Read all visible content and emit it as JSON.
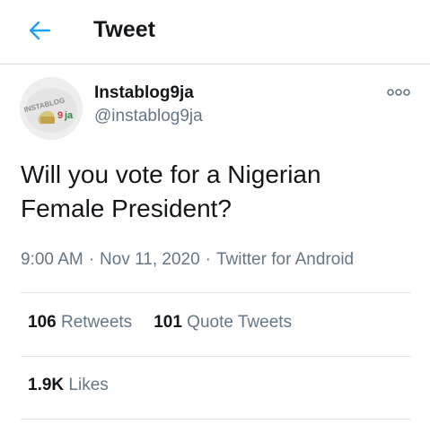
{
  "header": {
    "title": "Tweet",
    "back_icon": "arrow-left-icon",
    "accent": "#1da1f2"
  },
  "author": {
    "name": "Instablog9ja",
    "handle": "@instablog9ja",
    "avatar_icon": "instablog9ja-logo"
  },
  "tweet": {
    "text": "Will you vote for a Nigerian Female President?",
    "time": "9:00 AM",
    "date": "Nov 11, 2020",
    "separator": "·",
    "source": "Twitter for Android"
  },
  "stats": {
    "retweets_count": "106",
    "retweets_label": "Retweets",
    "quotes_count": "101",
    "quotes_label": "Quote Tweets",
    "likes_count": "1.9K",
    "likes_label": "Likes"
  },
  "colors": {
    "text_primary": "#14171a",
    "text_secondary": "#657786",
    "divider": "#e1e6ea"
  }
}
